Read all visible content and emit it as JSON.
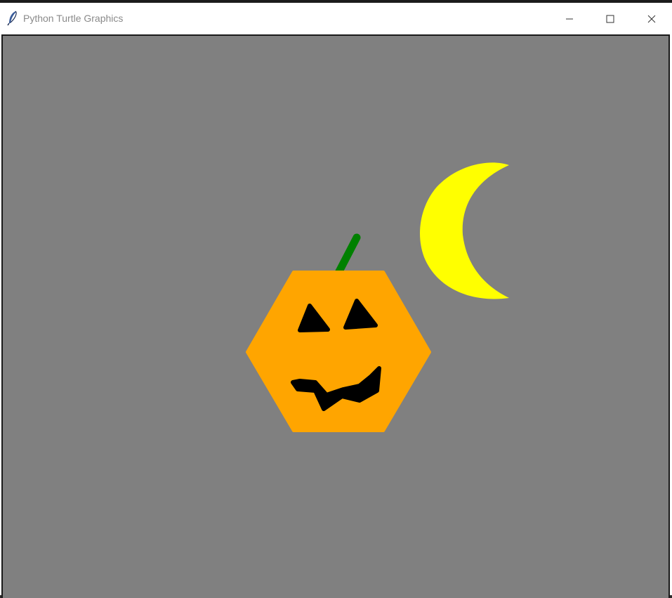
{
  "window": {
    "title": "Python Turtle Graphics"
  },
  "icons": {
    "app": "feather-icon",
    "minimize": "minimize-icon",
    "maximize": "maximize-icon",
    "close": "close-icon"
  },
  "colors": {
    "canvas_background": "#808080",
    "pumpkin": "#FFA500",
    "stem": "#008000",
    "moon": "#FFFF00",
    "face_features": "#000000"
  }
}
